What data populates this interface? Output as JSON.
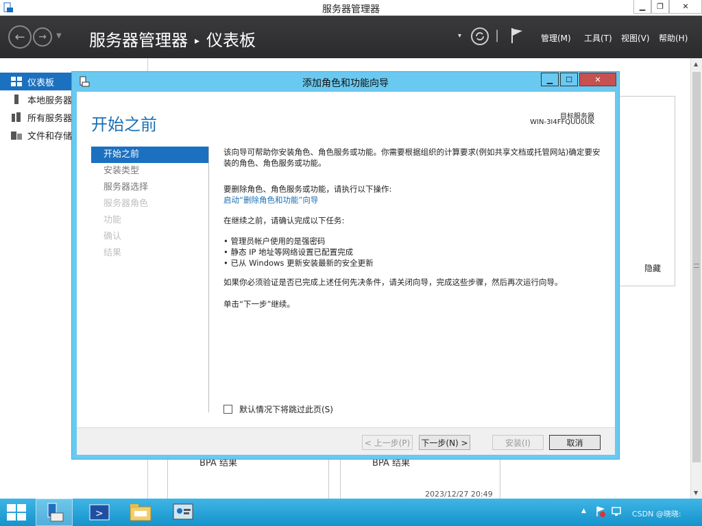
{
  "app": {
    "window_title": "服务器管理器",
    "breadcrumb_root": "服务器管理器",
    "breadcrumb_current": "仪表板",
    "menu": [
      "管理(M)",
      "工具(T)",
      "视图(V)",
      "帮助(H)"
    ]
  },
  "sidebar": {
    "items": [
      {
        "label": "仪表板",
        "icon": "dashboard-icon",
        "active": true
      },
      {
        "label": "本地服务器",
        "icon": "local-server-icon",
        "active": false
      },
      {
        "label": "所有服务器",
        "icon": "all-servers-icon",
        "active": false
      },
      {
        "label": "文件和存储服务",
        "icon": "file-storage-icon",
        "active": false
      }
    ]
  },
  "background": {
    "hide_label": "隐藏",
    "tile1_label": "BPA 结果",
    "tile2_label": "BPA 结果",
    "timestamp": "2023/12/27 20:49"
  },
  "wizard": {
    "title": "添加角色和功能向导",
    "heading": "开始之前",
    "target_label": "目标服务器",
    "target_name": "WIN-3I4FFQUU0UK",
    "steps": [
      {
        "label": "开始之前",
        "state": "current"
      },
      {
        "label": "安装类型",
        "state": "enabled"
      },
      {
        "label": "服务器选择",
        "state": "enabled"
      },
      {
        "label": "服务器角色",
        "state": "disabled"
      },
      {
        "label": "功能",
        "state": "disabled"
      },
      {
        "label": "确认",
        "state": "disabled"
      },
      {
        "label": "结果",
        "state": "disabled"
      }
    ],
    "intro": "该向导可帮助你安装角色、角色服务或功能。你需要根据组织的计算要求(例如共享文档或托管网站)确定要安装的角色、角色服务或功能。",
    "remove_intro": "要删除角色、角色服务或功能，请执行以下操作:",
    "remove_link": "启动“删除角色和功能”向导",
    "tasks_intro": "在继续之前，请确认完成以下任务:",
    "tasks": [
      "• 管理员帐户使用的是强密码",
      "• 静态 IP 地址等网络设置已配置完成",
      "• 已从 Windows 更新安装最新的安全更新"
    ],
    "verify_text": "如果你必须验证是否已完成上述任何先决条件，请关闭向导，完成这些步骤，然后再次运行向导。",
    "continue_text": "单击“下一步”继续。",
    "skip_label": "默认情况下将跳过此页(S)",
    "buttons": {
      "prev": "< 上一步(P)",
      "next": "下一步(N) >",
      "install": "安装(I)",
      "cancel": "取消"
    }
  },
  "taskbar": {
    "watermark": "CSDN @晓晓:"
  }
}
